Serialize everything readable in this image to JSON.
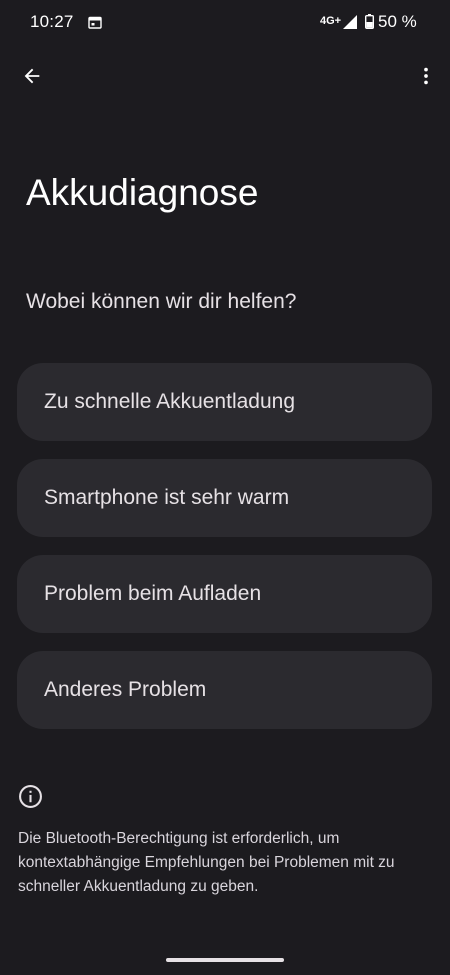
{
  "status_bar": {
    "time": "10:27",
    "network": "4G+",
    "battery": "50 %"
  },
  "top_bar": {
    "back_icon": "arrow-back-icon",
    "more_icon": "more-vert-icon"
  },
  "page": {
    "title": "Akkudiagnose",
    "prompt": "Wobei können wir dir helfen?"
  },
  "options": [
    {
      "label": "Zu schnelle Akkuentladung"
    },
    {
      "label": "Smartphone ist sehr warm"
    },
    {
      "label": "Problem beim Aufladen"
    },
    {
      "label": "Anderes Problem"
    }
  ],
  "info": {
    "icon": "info-icon",
    "text": "Die Bluetooth-Berechtigung ist erforderlich, um kontextabhängige Empfehlungen bei Problemen mit zu schneller Akkuentladung zu geben."
  },
  "colors": {
    "background": "#1c1b1f",
    "card": "#2b2a2f",
    "text": "#e6e1e5"
  }
}
